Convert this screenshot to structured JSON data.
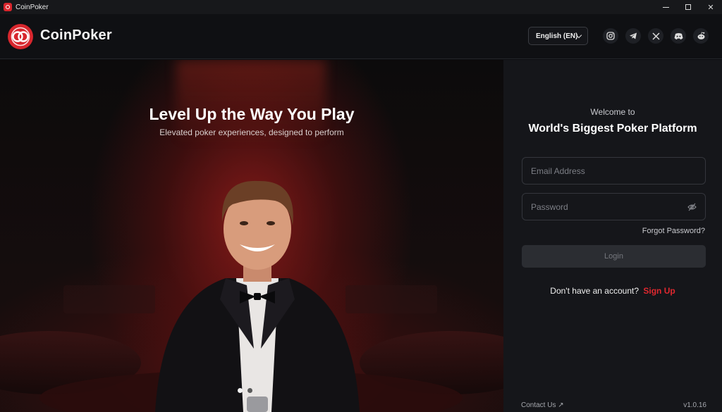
{
  "window": {
    "title": "CoinPoker",
    "controls": {
      "minimize_icon": "minimize-icon",
      "maximize_icon": "maximize-icon",
      "close_glyph": "✕"
    }
  },
  "header": {
    "brand": "CoinPoker",
    "language": "English (EN)",
    "social": [
      "instagram-icon",
      "telegram-icon",
      "x-icon",
      "discord-icon",
      "reddit-icon"
    ]
  },
  "hero": {
    "title": "Level Up the Way You Play",
    "subtitle": "Elevated poker experiences, designed to perform",
    "carousel": {
      "total": 2,
      "active": 1
    }
  },
  "login": {
    "welcome": "Welcome to",
    "platform": "World's Biggest Poker Platform",
    "email_placeholder": "Email Address",
    "password_placeholder": "Password",
    "forgot": "Forgot Password?",
    "login_label": "Login",
    "no_account": "Don't have an account?",
    "signup": "Sign Up"
  },
  "footer": {
    "contact": "Contact Us ↗",
    "version": "v1.0.16"
  },
  "colors": {
    "accent": "#d7262d",
    "panel": "#15161a",
    "background": "#0f1013"
  }
}
